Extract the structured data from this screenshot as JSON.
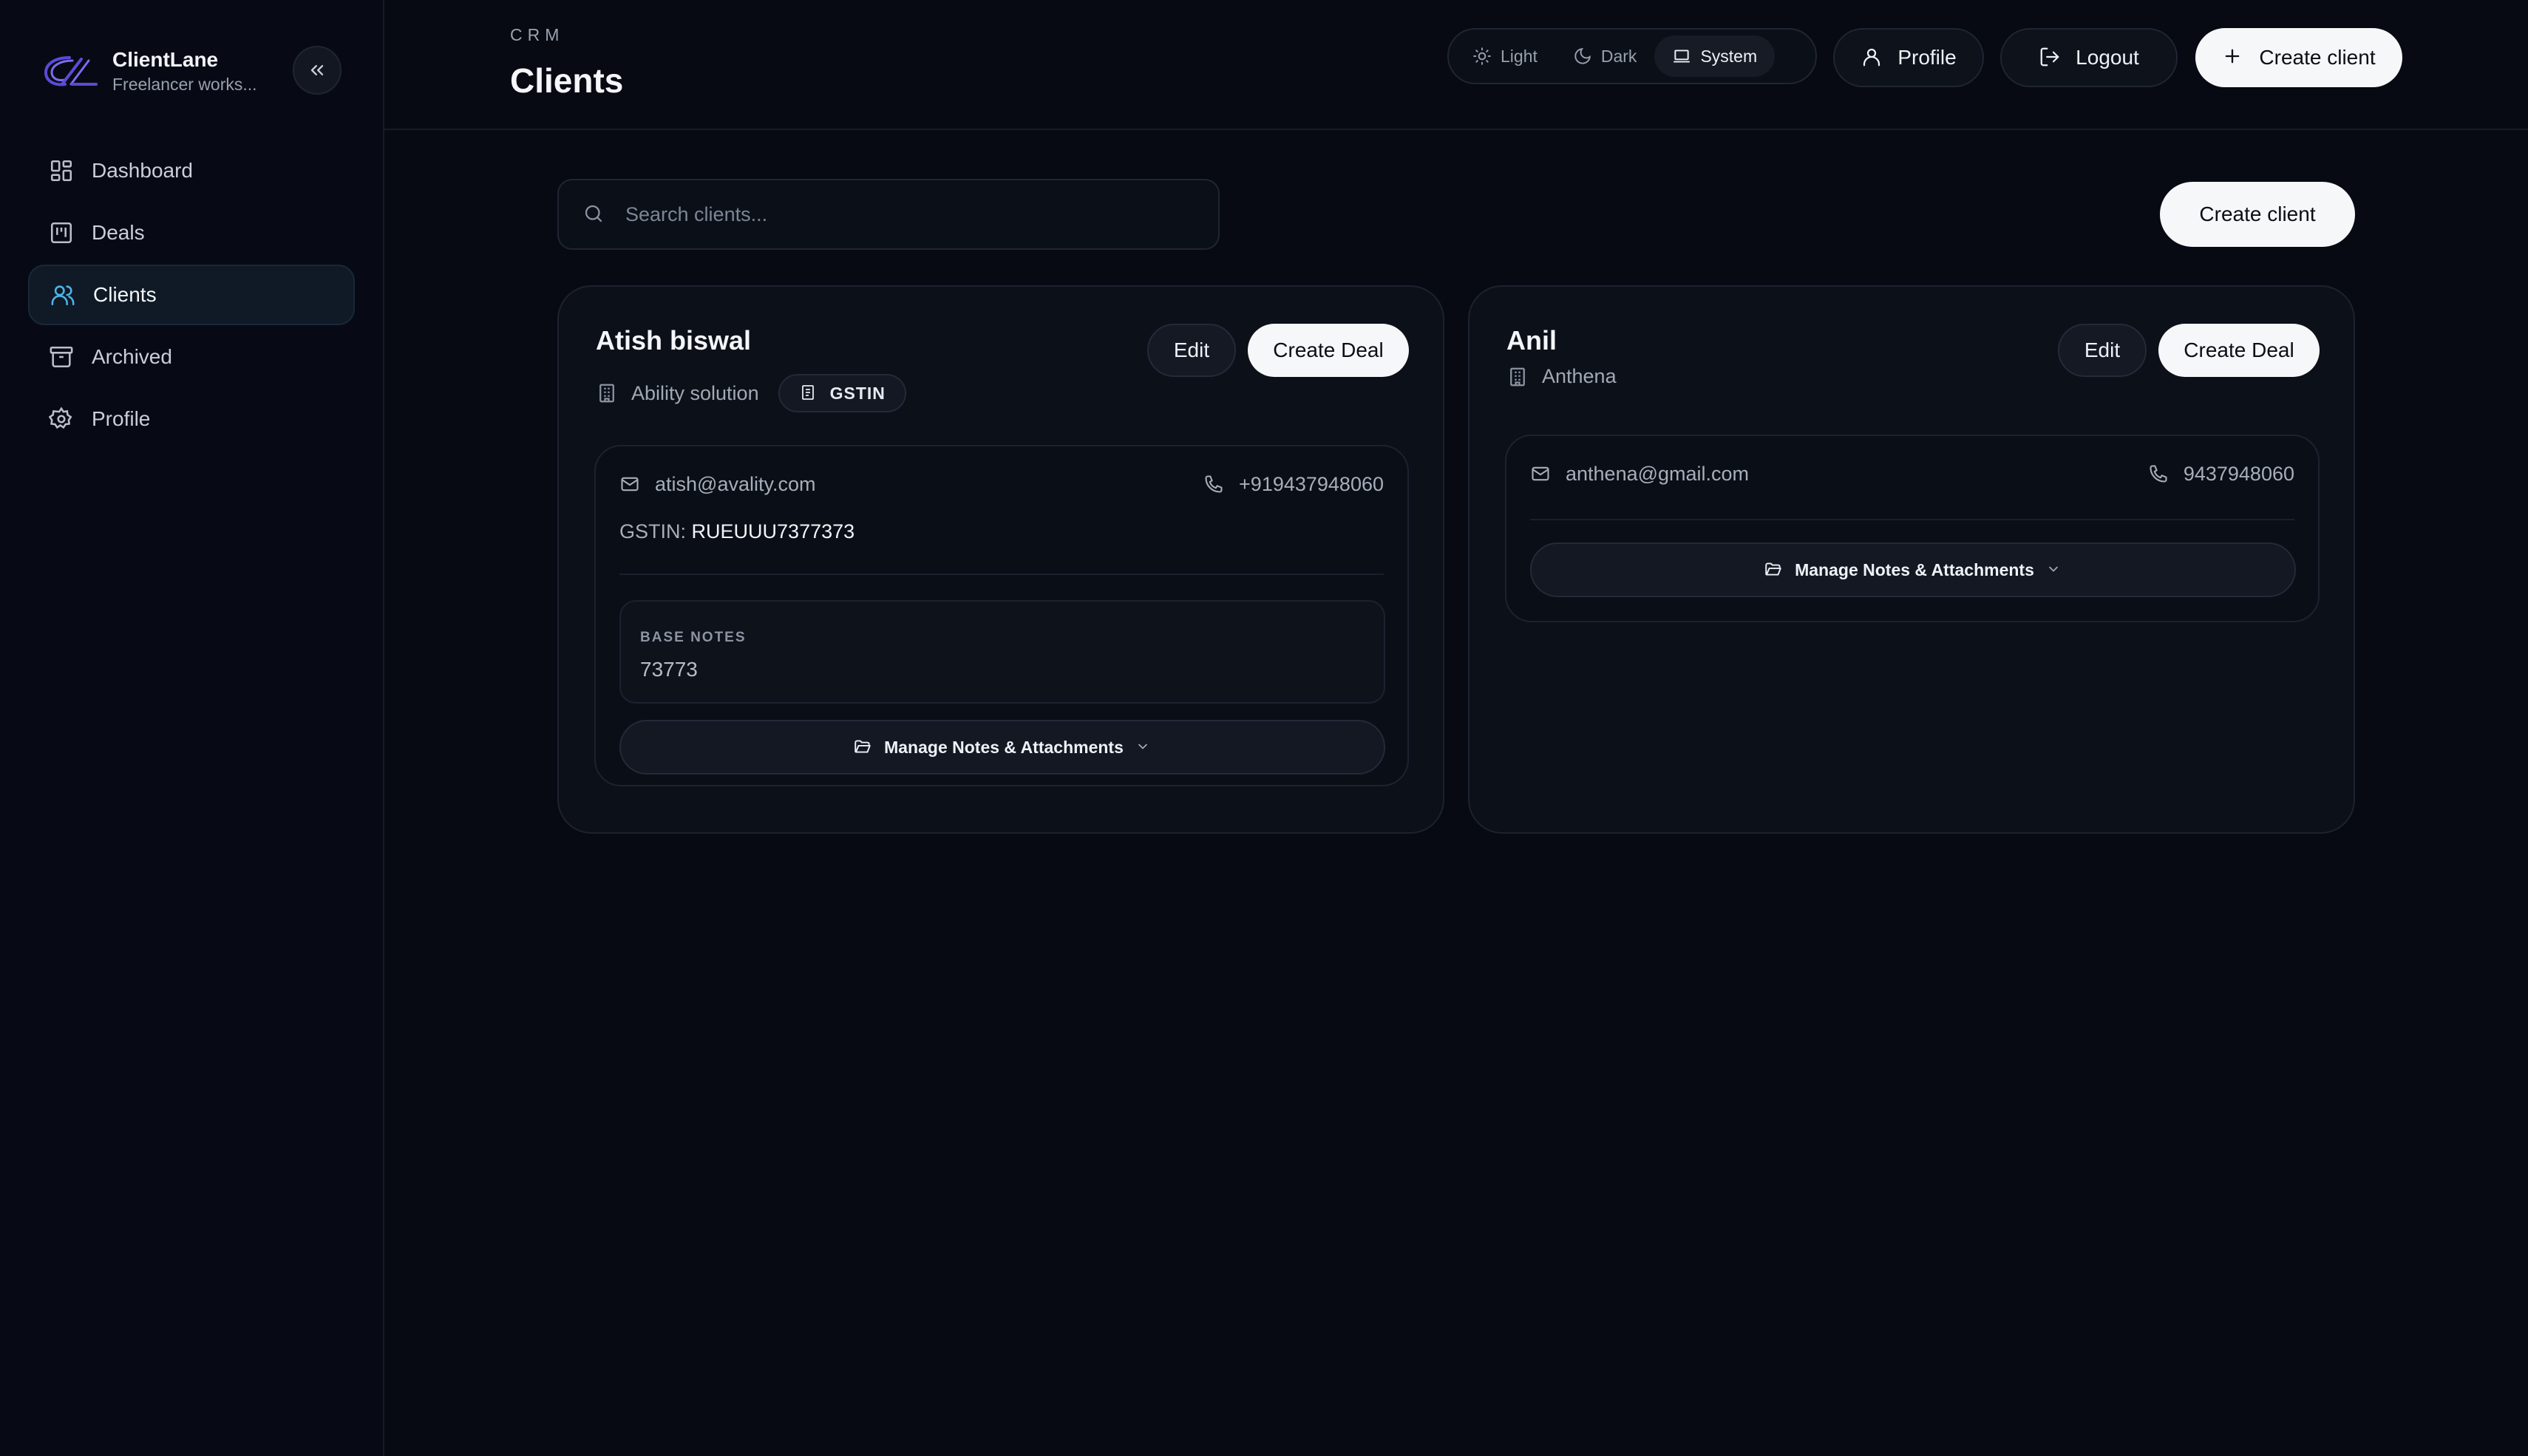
{
  "brand": {
    "name": "ClientLane",
    "subtitle": "Freelancer works...",
    "logo_icon": "cl-logo-icon",
    "accent": "#5b4bd6"
  },
  "sidebar": {
    "collapse_icon": "chevrons-left-icon",
    "items": [
      {
        "label": "Dashboard",
        "icon": "grid-icon",
        "active": false
      },
      {
        "label": "Deals",
        "icon": "kanban-icon",
        "active": false
      },
      {
        "label": "Clients",
        "icon": "users-icon",
        "active": true
      },
      {
        "label": "Archived",
        "icon": "archive-icon",
        "active": false
      },
      {
        "label": "Profile",
        "icon": "gear-icon",
        "active": false
      }
    ]
  },
  "header": {
    "crumb": "CRM",
    "title": "Clients",
    "theme": {
      "options": [
        {
          "label": "Light",
          "icon": "sun-icon"
        },
        {
          "label": "Dark",
          "icon": "moon-icon"
        },
        {
          "label": "System",
          "icon": "laptop-icon"
        }
      ],
      "selected": "System"
    },
    "profile_label": "Profile",
    "logout_label": "Logout",
    "create_label": "Create client"
  },
  "main": {
    "search_placeholder": "Search clients...",
    "create_label": "Create client",
    "clients": [
      {
        "name": "Atish biswal",
        "company": "Ability solution",
        "tag": "GSTIN",
        "email": "atish@avality.com",
        "phone": "+919437948060",
        "gstin_label": "GSTIN:",
        "gstin": "RUEUUU7377373",
        "notes_label": "BASE NOTES",
        "notes": "73773",
        "edit_label": "Edit",
        "deal_label": "Create Deal",
        "manage_label": "Manage Notes & Attachments"
      },
      {
        "name": "Anil",
        "company": "Anthena",
        "email": "anthena@gmail.com",
        "phone": "9437948060",
        "edit_label": "Edit",
        "deal_label": "Create Deal",
        "manage_label": "Manage Notes & Attachments"
      }
    ]
  },
  "colors": {
    "background": "#070a12",
    "card": "#0c1018",
    "primary_button": "#f6f7f9",
    "active_nav_icon": "#4fb3e8"
  }
}
